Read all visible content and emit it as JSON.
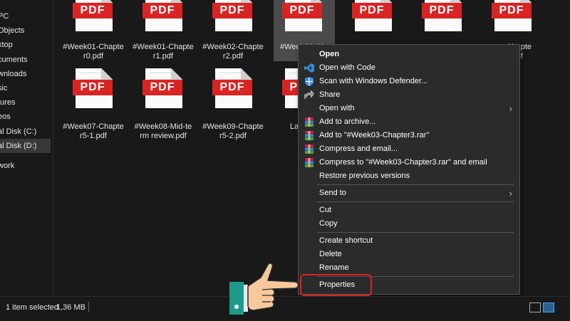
{
  "sidebar": {
    "items": [
      {
        "label": "PC"
      },
      {
        "label": "Objects"
      },
      {
        "label": "ktop"
      },
      {
        "label": "cuments"
      },
      {
        "label": "wnloads"
      },
      {
        "label": "sic"
      },
      {
        "label": "tures"
      },
      {
        "label": "eos"
      },
      {
        "label": "al Disk (C:)"
      },
      {
        "label": "al Disk (D:)"
      },
      {
        "label": "work"
      }
    ]
  },
  "files": [
    {
      "badge": "PDF",
      "name_line1": "#Week01-Chapte",
      "name_line2": "r0.pdf"
    },
    {
      "badge": "PDF",
      "name_line1": "#Week01-Chapte",
      "name_line2": "r1.pdf"
    },
    {
      "badge": "PDF",
      "name_line1": "#Week02-Chapte",
      "name_line2": "r2.pdf"
    },
    {
      "badge": "PDF",
      "name_line1": "#Week03-Ch",
      "name_line2": "r"
    },
    {
      "badge": "PDF",
      "name_line1": "",
      "name_line2": ""
    },
    {
      "badge": "PDF",
      "name_line1": "",
      "name_line2": ""
    },
    {
      "badge": "PDF",
      "name_line1": "-Chapte",
      "name_line2": ".pdf"
    },
    {
      "badge": "PDF",
      "name_line1": "#Week07-Chapte",
      "name_line2": "r5-1.pdf"
    },
    {
      "badge": "PDF",
      "name_line1": "#Week08-Mid-te",
      "name_line2": "rm review.pdf"
    },
    {
      "badge": "PDF",
      "name_line1": "#Week09-Chapte",
      "name_line2": "r5-2.pdf"
    },
    {
      "badge": "PDF",
      "name_line1": "La",
      "name_line2": ""
    }
  ],
  "context_menu": {
    "items": [
      {
        "label": "Open"
      },
      {
        "label": "Open with Code"
      },
      {
        "label": "Scan with Windows Defender..."
      },
      {
        "label": "Share"
      },
      {
        "label": "Open with"
      },
      {
        "label": "Add to archive..."
      },
      {
        "label": "Add to \"#Week03-Chapter3.rar\""
      },
      {
        "label": "Compress and email..."
      },
      {
        "label": "Compress to \"#Week03-Chapter3.rar\" and email"
      },
      {
        "label": "Restore previous versions"
      },
      {
        "label": "Send to"
      },
      {
        "label": "Cut"
      },
      {
        "label": "Copy"
      },
      {
        "label": "Create shortcut"
      },
      {
        "label": "Delete"
      },
      {
        "label": "Rename"
      },
      {
        "label": "Properties"
      }
    ]
  },
  "statusbar": {
    "selection": "1 item selected",
    "size": "1,36 MB"
  },
  "colors": {
    "pdf_badge": "#d92424",
    "highlight": "#e02020",
    "menu_bg": "#2b2b2b"
  }
}
